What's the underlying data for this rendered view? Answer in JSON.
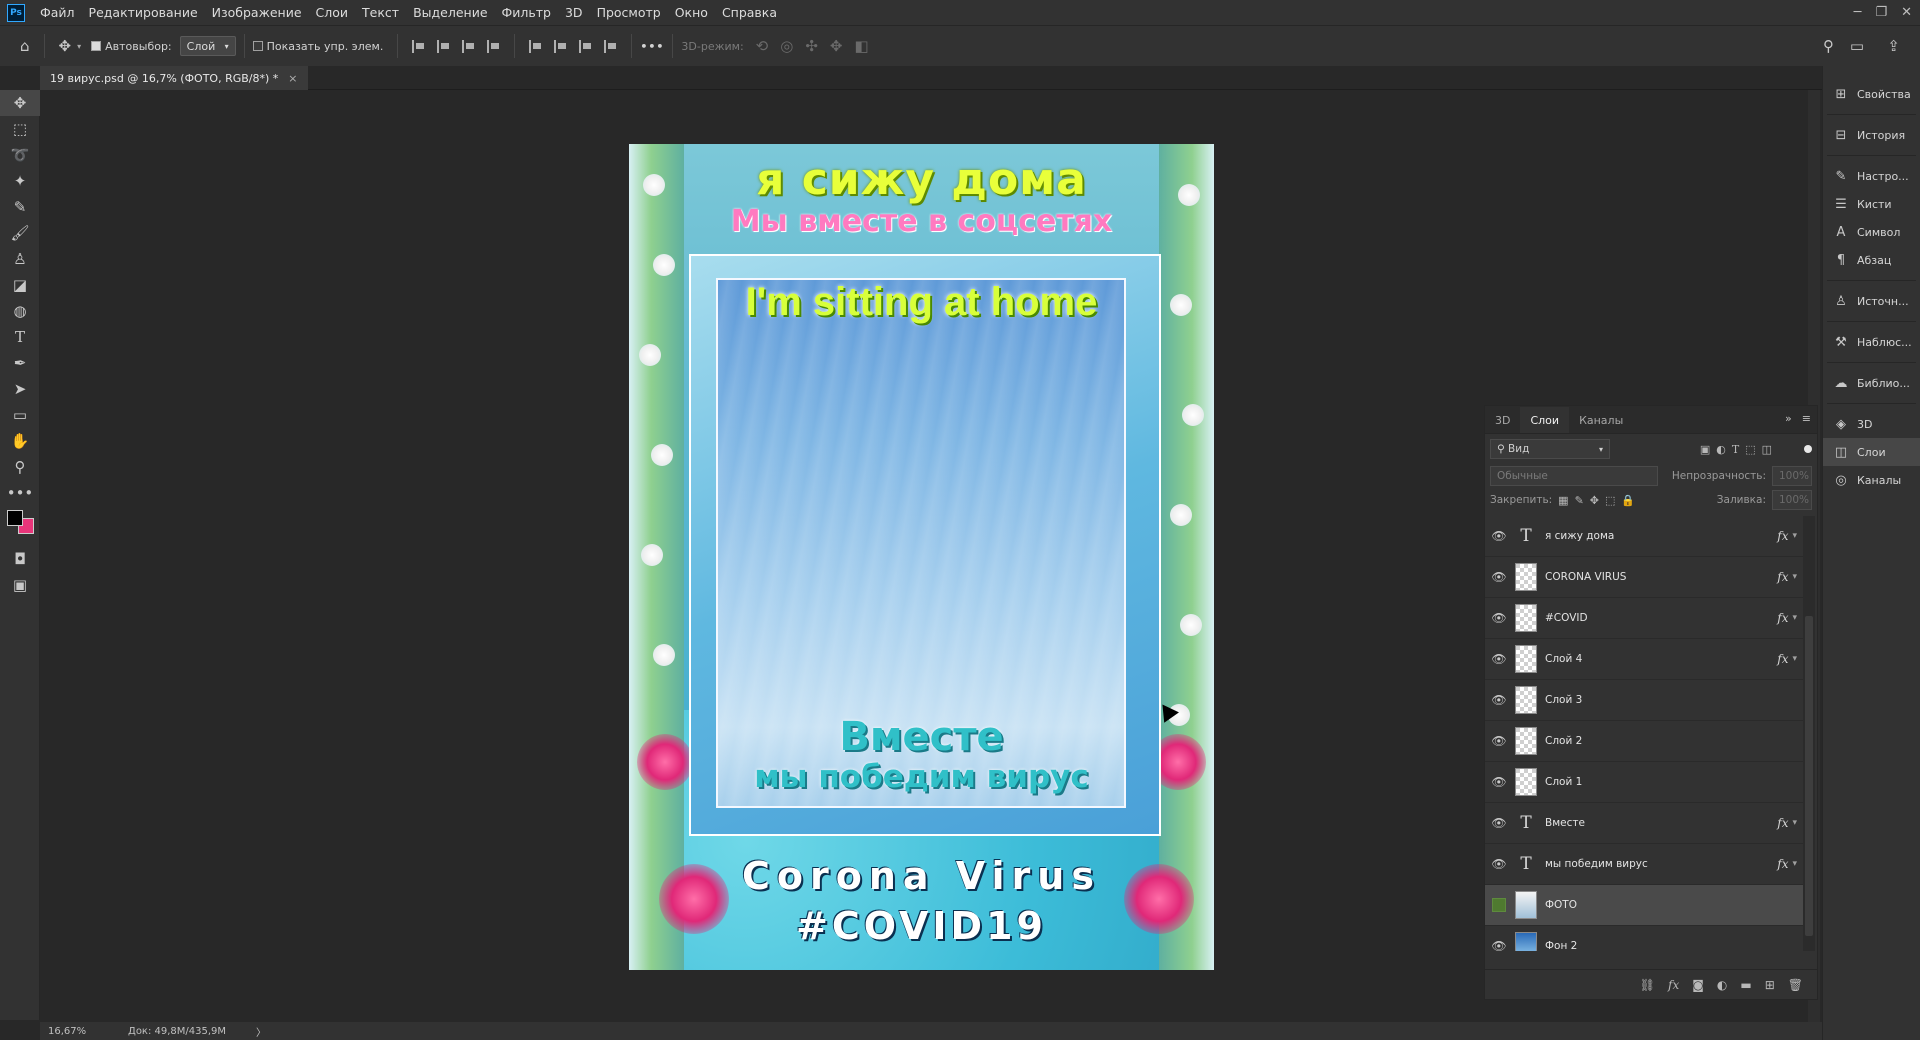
{
  "menu": {
    "logo": "Ps",
    "items": [
      "Файл",
      "Редактирование",
      "Изображение",
      "Слои",
      "Текст",
      "Выделение",
      "Фильтр",
      "3D",
      "Просмотр",
      "Окно",
      "Справка"
    ]
  },
  "options": {
    "autoselect_label": "Автовыбор:",
    "autoselect_value": "Слой",
    "show_transform_label": "Показать упр. элем.",
    "mode_3d_label": "3D-режим:",
    "more": "•••"
  },
  "tab": {
    "title": "19 вирус.psd @ 16,7% (ФОТО, RGB/8*) *",
    "close": "×"
  },
  "poster": {
    "title": "я сижу дома",
    "subtitle": "Мы вместе в соцсетях",
    "english": "I'm sitting at home",
    "vmeste": "Вместе",
    "pobedim": "мы победим вирус",
    "corona": "Corona Virus",
    "covid": "#COVID19"
  },
  "status": {
    "zoom": "16,67%",
    "doc": "Док: 49,8M/435,9M",
    "arrow": "〉"
  },
  "dock": {
    "items": [
      "Свойства",
      "История",
      "Настро...",
      "Кисти",
      "Символ",
      "Абзац",
      "Источн...",
      "Наблюс...",
      "Библио...",
      "3D",
      "Слои",
      "Каналы"
    ]
  },
  "layers_panel": {
    "tabs": [
      "3D",
      "Слои",
      "Каналы"
    ],
    "filter_label": "Вид",
    "blend_mode": "Обычные",
    "opacity_label": "Непрозрачность:",
    "opacity_value": "100%",
    "lock_label": "Закрепить:",
    "fill_label": "Заливка:",
    "fill_value": "100%",
    "layers": [
      {
        "name": "я сижу дома",
        "type": "text",
        "fx": true,
        "visible": true,
        "selected": false
      },
      {
        "name": "CORONA VIRUS",
        "type": "raster",
        "fx": true,
        "visible": true,
        "selected": false
      },
      {
        "name": "#COVID",
        "type": "raster",
        "fx": true,
        "visible": true,
        "selected": false
      },
      {
        "name": "Слой 4",
        "type": "raster",
        "fx": true,
        "visible": true,
        "selected": false
      },
      {
        "name": "Слой 3",
        "type": "raster",
        "fx": false,
        "visible": true,
        "selected": false
      },
      {
        "name": "Слой 2",
        "type": "raster",
        "fx": false,
        "visible": true,
        "selected": false
      },
      {
        "name": "Слой 1",
        "type": "raster",
        "fx": false,
        "visible": true,
        "selected": false
      },
      {
        "name": "Вместе",
        "type": "text",
        "fx": true,
        "visible": true,
        "selected": false
      },
      {
        "name": "мы победим вирус",
        "type": "text",
        "fx": true,
        "visible": true,
        "selected": false
      },
      {
        "name": "ФОТО",
        "type": "photo",
        "fx": false,
        "visible": false,
        "selected": true
      },
      {
        "name": "Фон 2",
        "type": "blue",
        "fx": false,
        "visible": true,
        "selected": false
      }
    ],
    "fx_symbol": "fx"
  },
  "colors": {
    "foreground": "#000000",
    "background": "#e8357a",
    "accent": "#31a8ff"
  }
}
